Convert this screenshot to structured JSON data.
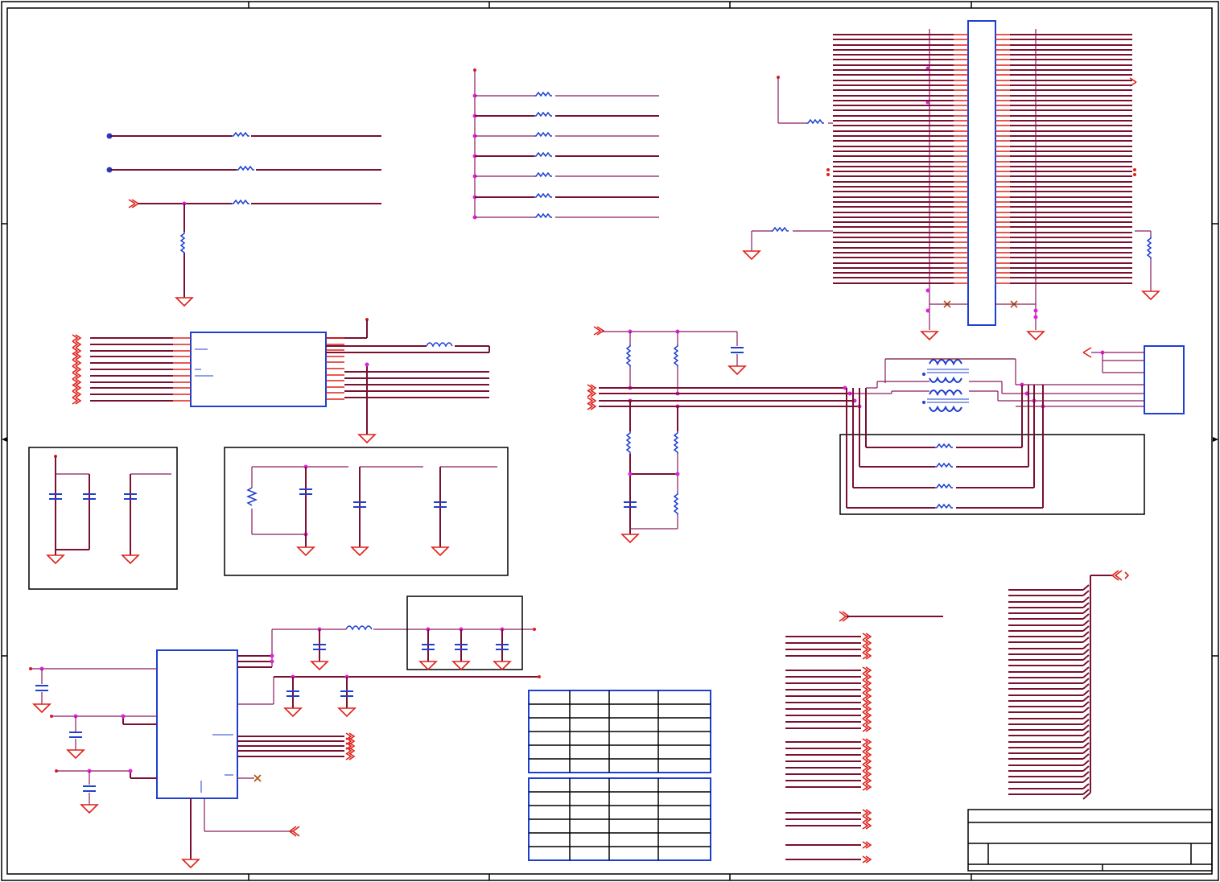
{
  "sheet": {
    "title_block_label": "",
    "page_bg": "#ffffff"
  },
  "colors": {
    "wire": "#7a1030",
    "thin_wire": "#8a1a60",
    "pin": "#e0201a",
    "component": "#1f3fd0",
    "junction": "#e020e0",
    "no_connect": "#b05010",
    "frame": "#000000"
  },
  "icons": {
    "ground": "ground-symbol",
    "power_port": "power-port-symbol",
    "offpage": "offpage-connector-arrow",
    "no_connect": "no-connect-x"
  },
  "tables": {
    "upper_rows": 5,
    "upper_cols": 4,
    "lower_rows": 6,
    "lower_cols": 4
  }
}
